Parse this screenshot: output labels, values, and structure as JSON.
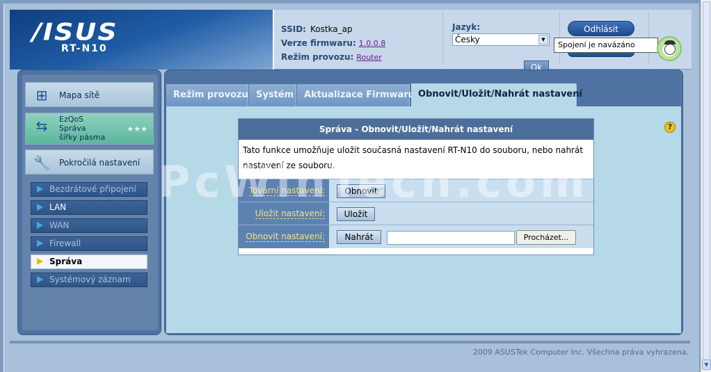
{
  "header": {
    "brand": "/ISUS",
    "model": "RT-N10",
    "ssid_label": "SSID:",
    "ssid_value": "Kostka_ap",
    "firmware_label": "Verze firmwaru:",
    "firmware_value": "1.0.0.8",
    "mode_label": "Režim provozu:",
    "mode_value": "Router",
    "language_label": "Jazyk:",
    "language_value": "Česky",
    "ok_label": "Ok",
    "logout_label": "Odhlásit",
    "connection_tooltip": "Spojení je navázáno"
  },
  "sidebar": {
    "main": [
      {
        "label": "Mapa sítě",
        "icon": "network-map-icon"
      },
      {
        "label": "EzQoS\nSpráva\nšířky pásma",
        "icon": "bandwidth-icon"
      },
      {
        "label": "Pokročilá nastavení",
        "icon": "tools-icon"
      }
    ],
    "sub": [
      {
        "label": "Bezdrátové připojení"
      },
      {
        "label": "LAN"
      },
      {
        "label": "WAN"
      },
      {
        "label": "Firewall"
      },
      {
        "label": "Správa"
      },
      {
        "label": "Systémový záznam"
      }
    ]
  },
  "tabs": [
    {
      "label": "Režim provozu"
    },
    {
      "label": "Systém"
    },
    {
      "label": "Aktualizace Firmwaru"
    },
    {
      "label": "Obnovit/Uložit/Nahrát nastavení"
    }
  ],
  "box": {
    "title": "Správa - Obnovit/Uložit/Nahrát nastavení",
    "description": "Tato funkce umožňuje uložit současná nastavení RT-N10 do souboru, nebo nahrát nastavení ze souboru.",
    "rows": [
      {
        "label": "Tovární nastavení:",
        "button": "Obnovit"
      },
      {
        "label": "Uložit nastavení:",
        "button": "Uložit"
      },
      {
        "label": "Obnovit nastavení:",
        "button": "Nahrát",
        "browse": "Procházet..."
      }
    ]
  },
  "watermark": "PcWinTech.com",
  "footer": "2009 ASUSTek Computer Inc. Všechna práva vyhrazena."
}
